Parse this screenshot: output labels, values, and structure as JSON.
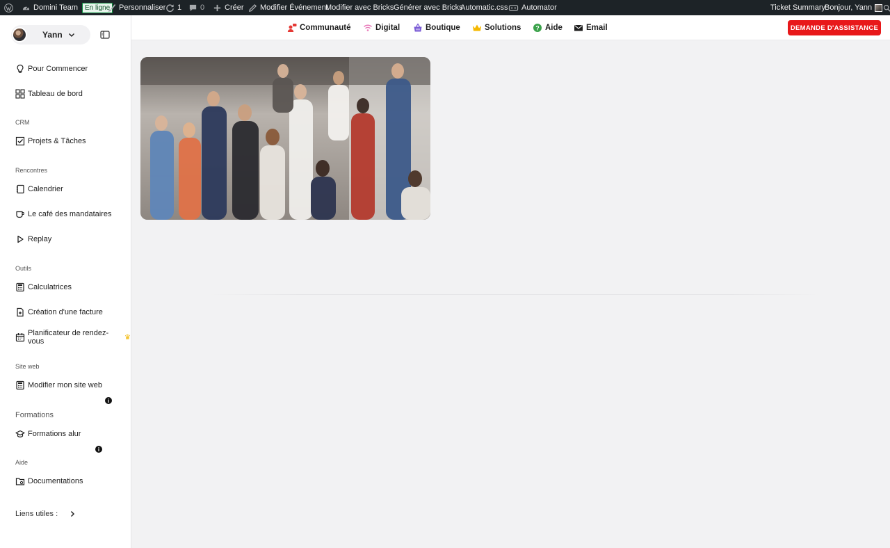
{
  "adminbar": {
    "site_name": "Domini Team",
    "status_badge": "En ligne",
    "customize": "Personnaliser",
    "updates_count": "1",
    "comments_count": "0",
    "create": "Créer",
    "edit_event": "Modifier Événement",
    "edit_bricks": "Modifier avec Bricks",
    "generate_bricks": "Générer avec Bricks",
    "automatic_css": "Automatic.css",
    "automator": "Automator",
    "ticket_summary": "Ticket Summary",
    "greeting": "Bonjour, Yann"
  },
  "sidebar": {
    "user_name": "Yann",
    "items": {
      "start": "Pour Commencer",
      "dashboard": "Tableau de bord",
      "projects": "Projets & Tâches",
      "calendar": "Calendrier",
      "cafe": "Le café des mandataires",
      "replay": "Replay",
      "calculators": "Calculatrices",
      "invoice": "Création d'une facture",
      "scheduler": "Planificateur de rendez-vous",
      "edit_site": "Modifier mon site web",
      "trainings": "Formations alur",
      "docs": "Documentations",
      "links": "Liens utiles :"
    },
    "sections": {
      "crm": "CRM",
      "meetings": "Rencontres",
      "tools": "Outils",
      "website": "Site web",
      "trainings": "Formations",
      "help": "Aide"
    },
    "info_glyph": "i"
  },
  "topmenu": {
    "community": "Communauté",
    "digital": "Digital",
    "shop": "Boutique",
    "solutions": "Solutions",
    "help": "Aide",
    "email": "Email",
    "assistance_button": "DEMANDE D'ASSISTANCE"
  },
  "colors": {
    "admin_bar": "#1d2327",
    "accent_red": "#e8181a",
    "page_bg": "#f2f2f3"
  }
}
